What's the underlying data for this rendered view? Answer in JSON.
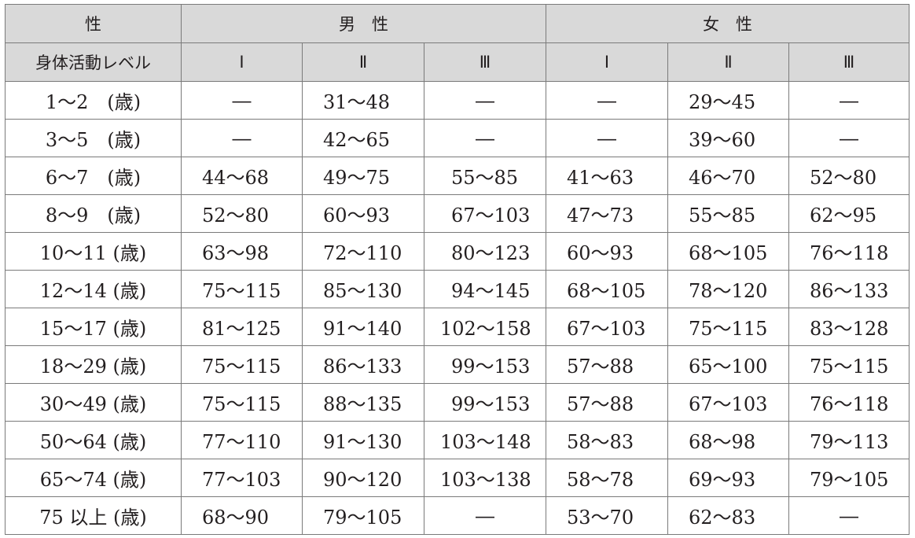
{
  "header": {
    "sex_label": "性",
    "male_label": "男　性",
    "female_label": "女　性",
    "level_label": "身体活動レベル",
    "levels": [
      "Ⅰ",
      "Ⅱ",
      "Ⅲ",
      "Ⅰ",
      "Ⅱ",
      "Ⅲ"
    ]
  },
  "rows": [
    {
      "age": "1～2　(歳)",
      "values": [
        "―",
        "31～48",
        "―",
        "―",
        "29～45",
        "―"
      ]
    },
    {
      "age": "3～5　(歳)",
      "values": [
        "―",
        "42～65",
        "―",
        "―",
        "39～60",
        "―"
      ]
    },
    {
      "age": "6～7　(歳)",
      "values": [
        "44～68",
        "49～75",
        "55～85",
        "41～63",
        "46～70",
        "52～80"
      ]
    },
    {
      "age": "8～9　(歳)",
      "values": [
        "52～80",
        "60～93",
        "67～103",
        "47～73",
        "55～85",
        "62～95"
      ]
    },
    {
      "age": "10～11 (歳)",
      "values": [
        "63～98",
        "72～110",
        "80～123",
        "60～93",
        "68～105",
        "76～118"
      ]
    },
    {
      "age": "12～14 (歳)",
      "values": [
        "75～115",
        "85～130",
        "94～145",
        "68～105",
        "78～120",
        "86～133"
      ]
    },
    {
      "age": "15～17 (歳)",
      "values": [
        "81～125",
        "91～140",
        "102～158",
        "67～103",
        "75～115",
        "83～128"
      ]
    },
    {
      "age": "18～29 (歳)",
      "values": [
        "75～115",
        "86～133",
        "99～153",
        "57～88",
        "65～100",
        "75～115"
      ]
    },
    {
      "age": "30～49 (歳)",
      "values": [
        "75～115",
        "88～135",
        "99～153",
        "57～88",
        "67～103",
        "76～118"
      ]
    },
    {
      "age": "50～64 (歳)",
      "values": [
        "77～110",
        "91～130",
        "103～148",
        "58～83",
        "68～98",
        "79～113"
      ]
    },
    {
      "age": "65～74 (歳)",
      "values": [
        "77～103",
        "90～120",
        "103～138",
        "58～78",
        "69～93",
        "79～105"
      ]
    },
    {
      "age": "75 以上 (歳)",
      "values": [
        "68～90",
        "79～105",
        "―",
        "53～70",
        "62～83",
        "―"
      ]
    }
  ]
}
